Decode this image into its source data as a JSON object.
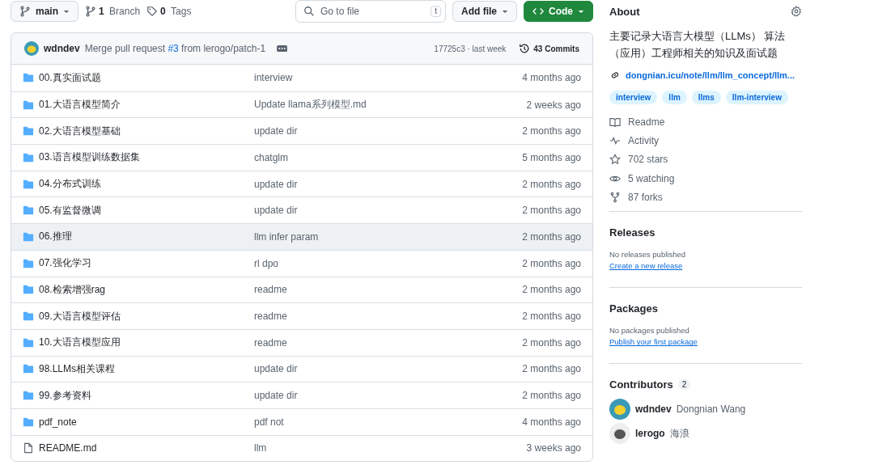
{
  "toolbar": {
    "branch": "main",
    "branches": {
      "count": "1",
      "label": "Branch"
    },
    "tags": {
      "count": "0",
      "label": "Tags"
    },
    "search": {
      "placeholder": "Go to file",
      "shortcut": "t"
    },
    "add_file": "Add file",
    "code": "Code"
  },
  "commit_bar": {
    "author": "wdndev",
    "message_before": "Merge pull request",
    "pr": "#3",
    "message_after": "from lerogo/patch-1",
    "sha_time": "17725c3 · last week",
    "commits": "43 Commits"
  },
  "files": [
    {
      "kind": "folder",
      "name": "00.真实面试题",
      "message": "interview",
      "time": "4 months ago",
      "selected": false
    },
    {
      "kind": "folder",
      "name": "01.大语言模型简介",
      "message": "Update llama系列模型.md",
      "time": "2 weeks ago",
      "selected": false
    },
    {
      "kind": "folder",
      "name": "02.大语言模型基础",
      "message": "update dir",
      "time": "2 months ago",
      "selected": false
    },
    {
      "kind": "folder",
      "name": "03.语言模型训练数据集",
      "message": "chatglm",
      "time": "5 months ago",
      "selected": false
    },
    {
      "kind": "folder",
      "name": "04.分布式训练",
      "message": "update dir",
      "time": "2 months ago",
      "selected": false
    },
    {
      "kind": "folder",
      "name": "05.有监督微调",
      "message": "update dir",
      "time": "2 months ago",
      "selected": false
    },
    {
      "kind": "folder",
      "name": "06.推理",
      "message": "llm infer param",
      "time": "2 months ago",
      "selected": true
    },
    {
      "kind": "folder",
      "name": "07.强化学习",
      "message": "rl dpo",
      "time": "2 months ago",
      "selected": false
    },
    {
      "kind": "folder",
      "name": "08.检索增强rag",
      "message": "readme",
      "time": "2 months ago",
      "selected": false
    },
    {
      "kind": "folder",
      "name": "09.大语言模型评估",
      "message": "readme",
      "time": "2 months ago",
      "selected": false
    },
    {
      "kind": "folder",
      "name": "10.大语言模型应用",
      "message": "readme",
      "time": "2 months ago",
      "selected": false
    },
    {
      "kind": "folder",
      "name": "98.LLMs相关课程",
      "message": "update dir",
      "time": "2 months ago",
      "selected": false
    },
    {
      "kind": "folder",
      "name": "99.参考资料",
      "message": "update dir",
      "time": "2 months ago",
      "selected": false
    },
    {
      "kind": "folder",
      "name": "pdf_note",
      "message": "pdf not",
      "time": "4 months ago",
      "selected": false
    },
    {
      "kind": "file",
      "name": "README.md",
      "message": "llm",
      "time": "3 weeks ago",
      "selected": false
    }
  ],
  "about": {
    "title": "About",
    "description": "主要记录大语言大模型（LLMs） 算法（应用）工程师相关的知识及面试题",
    "link": "dongnian.icu/note/llm/llm_concept/llm...",
    "topics": [
      "interview",
      "llm",
      "llms",
      "llm-interview"
    ],
    "stats": [
      {
        "kind": "book",
        "label": "Readme"
      },
      {
        "kind": "pulse",
        "label": "Activity"
      },
      {
        "kind": "star",
        "label": "702 stars"
      },
      {
        "kind": "eye",
        "label": "5 watching"
      },
      {
        "kind": "fork",
        "label": "87 forks"
      }
    ]
  },
  "releases": {
    "title": "Releases",
    "note": "No releases published",
    "link": "Create a new release"
  },
  "packages": {
    "title": "Packages",
    "note": "No packages published",
    "link": "Publish your first package"
  },
  "contributors": {
    "title": "Contributors",
    "count": "2",
    "people": [
      {
        "login": "wdndev",
        "name": "Dongnian Wang"
      },
      {
        "login": "lerogo",
        "name": "海浪"
      }
    ]
  }
}
